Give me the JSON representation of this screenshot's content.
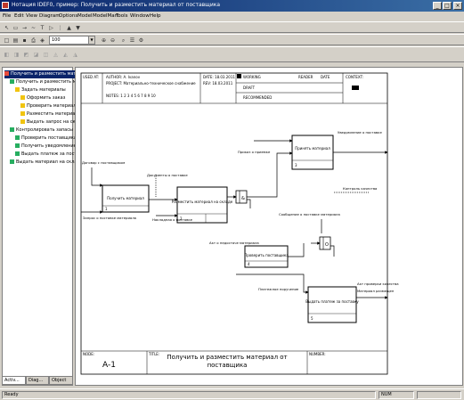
{
  "window": {
    "title": "Нотация IDEF0, пример: Получить и разместить материал от поставщика",
    "min": "_",
    "max": "□",
    "close": "×"
  },
  "menu": [
    "File",
    "Edit",
    "View",
    "Diagram",
    "Options",
    "Model",
    "ModelMart",
    "Tools",
    "Window",
    "Help"
  ],
  "toolbar": {
    "zoom_value": "100",
    "icons": [
      "new-icon",
      "open-icon",
      "save-icon",
      "print-icon",
      "zoom-in-icon",
      "zoom-out-icon",
      "grid-icon",
      "pointer-icon"
    ]
  },
  "tree": {
    "items": [
      {
        "label": "Получить и разместить материал",
        "color": "#e74c3c",
        "level": 0,
        "selected": true
      },
      {
        "label": "Получить и разместить материал",
        "color": "#27ae60",
        "level": 1
      },
      {
        "label": "Задать материалы",
        "color": "#f1c40f",
        "level": 2
      },
      {
        "label": "Оформить заказ",
        "color": "#f1c40f",
        "level": 3
      },
      {
        "label": "Проверить материал",
        "color": "#f1c40f",
        "level": 3
      },
      {
        "label": "Разместить материал",
        "color": "#f1c40f",
        "level": 3
      },
      {
        "label": "Выдать запрос на склад",
        "color": "#f1c40f",
        "level": 3
      },
      {
        "label": "Контролировать запасы",
        "color": "#27ae60",
        "level": 1
      },
      {
        "label": "Проверить поставщика",
        "color": "#27ae60",
        "level": 2
      },
      {
        "label": "Получить уведомление",
        "color": "#27ae60",
        "level": 2
      },
      {
        "label": "Выдать платеж за поставку",
        "color": "#27ae60",
        "level": 2
      },
      {
        "label": "Выдать материал на склад",
        "color": "#27ae60",
        "level": 1
      }
    ]
  },
  "tabs": [
    "Activ...",
    "Diag...",
    "Object"
  ],
  "diagram": {
    "header": {
      "used_at": "USED AT:",
      "author": "AUTHOR: A. Ivanov",
      "project": "PROJECT: Материально-техническое снабжение",
      "notes": "NOTES: 1 2 3 4 5 6 7 8 9 10",
      "date": "DATE: 18.03.2011",
      "rev": "REV: 18.03.2011",
      "status_working": "WORKING",
      "status_draft": "DRAFT",
      "status_recommended": "RECOMMENDED",
      "status_publication": "PUBLICATION",
      "reader": "READER",
      "date2": "DATE",
      "context": "CONTEXT:"
    },
    "footer": {
      "node_label": "NODE:",
      "node": "A-1",
      "title_label": "TITLE:",
      "title": "Получить и разместить материал от поставщика",
      "number_label": "NUMBER:"
    },
    "boxes": [
      {
        "label": "Получить материал",
        "num": "1"
      },
      {
        "label": "Разместить материал на складе",
        "num": "2"
      },
      {
        "label": "Принять материал",
        "num": "3"
      },
      {
        "label": "Проверить поставщика",
        "num": "4"
      },
      {
        "label": "Выдать платеж за поставку",
        "num": "5"
      }
    ],
    "labels": {
      "contract": "Договор с поставщиком",
      "request": "Запрос о поставке материала",
      "docs": "Документы о поставке",
      "shipment": "Накладная о поставке",
      "order": "Приказ о приемке",
      "notice": "Уведомление о поставке",
      "defect": "Акт о недостаче материала",
      "defect2": "Сообщение о поставке материала",
      "payment": "Платежное поручение",
      "quality": "Акт проверки качества",
      "done": "Материал размещен",
      "note": "Контроль качества",
      "and1": "&",
      "and2": "O"
    }
  },
  "status": {
    "left": "Ready",
    "right": "NUM"
  }
}
